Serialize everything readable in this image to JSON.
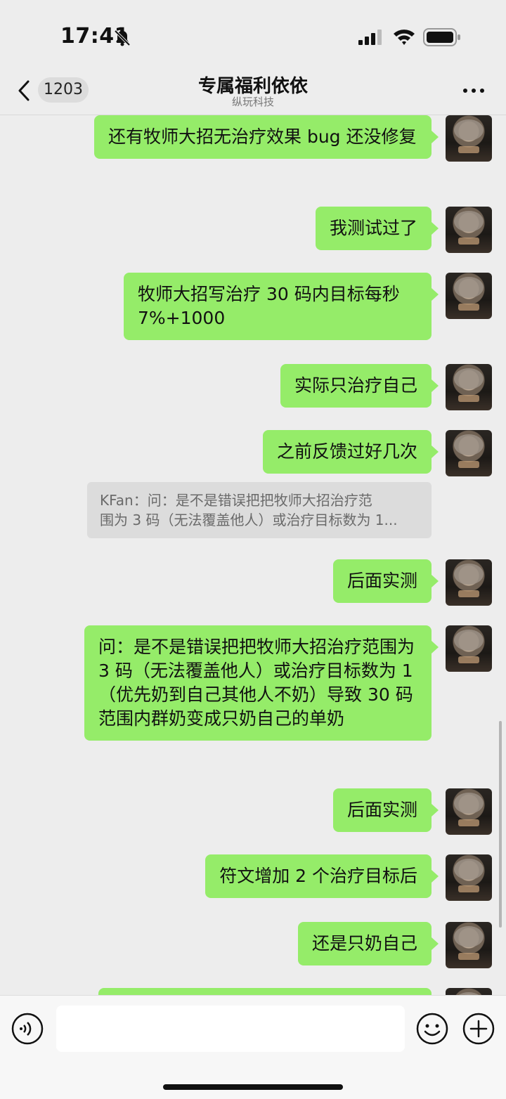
{
  "status_bar": {
    "time": "17:41",
    "icons": [
      "bell-muted-icon",
      "signal-icon",
      "wifi-icon",
      "battery-icon"
    ]
  },
  "nav": {
    "back_icon": "chevron-left-icon",
    "unread_count": "1203",
    "title": "专属福利依依",
    "subtitle": "纵玩科技",
    "more_icon": "more-dots-icon"
  },
  "messages": [
    {
      "text": "还有牧师大招无治疗效果 bug 还没修复"
    },
    {
      "text": "我测试过了"
    },
    {
      "text": "牧师大招写治疗 30 码内目标每秒7%+1000"
    },
    {
      "text": "实际只治疗自己"
    },
    {
      "text": "之前反馈过好几次"
    },
    {
      "text": "后面实测"
    },
    {
      "text": "问：是不是错误把把牧师大招治疗范围为 3 码（无法覆盖他人）或治疗目标数为 1（优先奶到自己其他人不奶）导致 30 码范围内群奶变成只奶自己的单奶"
    },
    {
      "text": "后面实测"
    },
    {
      "text": "符文增加 2 个治疗目标后"
    },
    {
      "text": "还是只奶自己"
    }
  ],
  "quote": {
    "line1": "KFan：问：是不是错误把把牧师大招治疗范",
    "line2": "围为 3 码（无法覆盖他人）或治疗目标数为 1..."
  },
  "input_bar": {
    "voice_icon": "voice-icon",
    "input_value": "",
    "emoji_icon": "emoji-icon",
    "plus_icon": "plus-icon"
  },
  "colors": {
    "bubble": "#95ec69",
    "background": "#ededed",
    "quote_bg": "#dcdcdc"
  }
}
